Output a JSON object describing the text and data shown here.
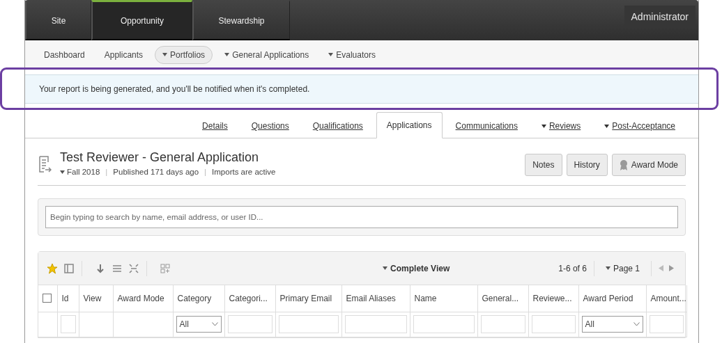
{
  "top_nav": {
    "tabs": [
      {
        "label": "Site",
        "selected": false
      },
      {
        "label": "Opportunity",
        "selected": true
      },
      {
        "label": "Stewardship",
        "selected": false
      }
    ],
    "user": "Administrator"
  },
  "sub_nav": [
    {
      "label": "Dashboard",
      "dropdown": false,
      "selected": false
    },
    {
      "label": "Applicants",
      "dropdown": false,
      "selected": false
    },
    {
      "label": "Portfolios",
      "dropdown": true,
      "selected": true
    },
    {
      "label": "General Applications",
      "dropdown": true,
      "selected": false
    },
    {
      "label": "Evaluators",
      "dropdown": true,
      "selected": false
    }
  ],
  "alert": {
    "text": "Your report is being generated, and you'll be notified when it's completed.",
    "highlighted": true
  },
  "section_tabs": [
    {
      "label": "Details",
      "dropdown": false,
      "selected": false
    },
    {
      "label": "Questions",
      "dropdown": false,
      "selected": false
    },
    {
      "label": "Qualifications",
      "dropdown": false,
      "selected": false
    },
    {
      "label": "Applications",
      "dropdown": false,
      "selected": true
    },
    {
      "label": "Communications",
      "dropdown": false,
      "selected": false
    },
    {
      "label": "Reviews",
      "dropdown": true,
      "selected": false
    },
    {
      "label": "Post-Acceptance",
      "dropdown": true,
      "selected": false
    }
  ],
  "header": {
    "title": "Test Reviewer - General Application",
    "separators": [
      "|",
      "|"
    ],
    "meta": [
      {
        "label": "Fall 2018",
        "dropdown": true
      },
      {
        "label": "Published 171 days ago",
        "dropdown": false
      },
      {
        "label": "Imports are active",
        "dropdown": false
      }
    ],
    "buttons": [
      {
        "label": "Notes",
        "kind": "plain"
      },
      {
        "label": "History",
        "kind": "plain"
      },
      {
        "label": "Award Mode",
        "kind": "award"
      }
    ]
  },
  "search": {
    "placeholder": "Begin typing to search by name, email address, or user ID..."
  },
  "grid": {
    "favorite": true,
    "view": "Complete View",
    "count": "1-6 of 6",
    "page": "Page 1",
    "select_all_checked": false,
    "columns": [
      {
        "label": "Id",
        "kind": "input"
      },
      {
        "label": "View",
        "kind": "none"
      },
      {
        "label": "Award Mode",
        "kind": "none"
      },
      {
        "label": "Category",
        "kind": "select",
        "filter_value": "All"
      },
      {
        "label": "Categori...",
        "kind": "input"
      },
      {
        "label": "Primary Email",
        "kind": "input"
      },
      {
        "label": "Email Aliases",
        "kind": "input"
      },
      {
        "label": "Name",
        "kind": "input"
      },
      {
        "label": "General...",
        "kind": "input"
      },
      {
        "label": "Reviewe...",
        "kind": "input"
      },
      {
        "label": "Award Period",
        "kind": "select",
        "filter_value": "All"
      },
      {
        "label": "Amount...",
        "kind": "input"
      }
    ]
  }
}
